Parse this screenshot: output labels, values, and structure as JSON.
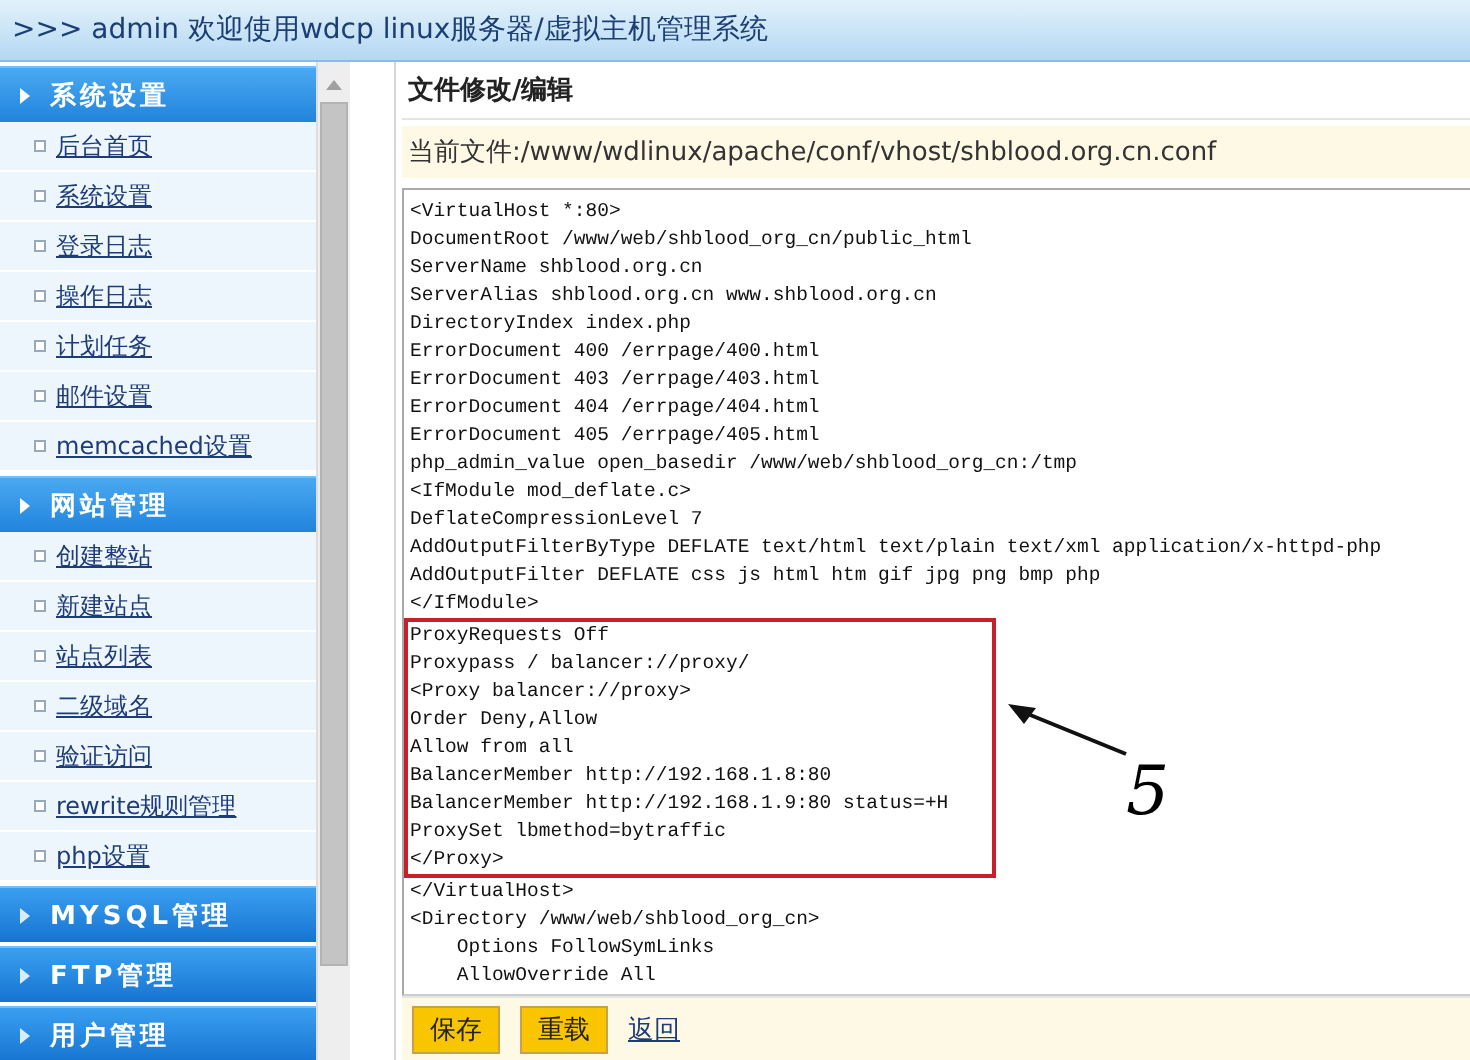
{
  "title_bar": {
    "text": ">>> admin 欢迎使用wdcp linux服务器/虚拟主机管理系统"
  },
  "sidebar": {
    "sections": [
      {
        "label": "系统设置",
        "expanded": true,
        "items": [
          "后台首页",
          "系统设置",
          "登录日志",
          "操作日志",
          "计划任务",
          "邮件设置",
          "memcached设置"
        ]
      },
      {
        "label": "网站管理",
        "expanded": true,
        "items": [
          "创建整站",
          "新建站点",
          "站点列表",
          "二级域名",
          "验证访问",
          "rewrite规则管理",
          "php设置"
        ]
      },
      {
        "label": "MYSQL管理",
        "expanded": false
      },
      {
        "label": "FTP管理",
        "expanded": false
      },
      {
        "label": "用户管理",
        "expanded": false
      }
    ]
  },
  "editor": {
    "heading": "文件修改/编辑",
    "current_file": "当前文件:/www/wdlinux/apache/conf/vhost/shblood.org.cn.conf",
    "lines": [
      {
        "text": "<VirtualHost *:80>",
        "highlighted": false
      },
      {
        "text": "DocumentRoot /www/web/shblood_org_cn/public_html",
        "highlighted": false
      },
      {
        "text": "ServerName shblood.org.cn",
        "highlighted": false
      },
      {
        "text": "ServerAlias shblood.org.cn www.shblood.org.cn",
        "highlighted": false
      },
      {
        "text": "DirectoryIndex index.php",
        "highlighted": false
      },
      {
        "text": "ErrorDocument 400 /errpage/400.html",
        "highlighted": false
      },
      {
        "text": "ErrorDocument 403 /errpage/403.html",
        "highlighted": false
      },
      {
        "text": "ErrorDocument 404 /errpage/404.html",
        "highlighted": false
      },
      {
        "text": "ErrorDocument 405 /errpage/405.html",
        "highlighted": false
      },
      {
        "text": "php_admin_value open_basedir /www/web/shblood_org_cn:/tmp",
        "highlighted": false
      },
      {
        "text": "<IfModule mod_deflate.c>",
        "highlighted": false
      },
      {
        "text": "DeflateCompressionLevel 7",
        "highlighted": false
      },
      {
        "text": "AddOutputFilterByType DEFLATE text/html text/plain text/xml application/x-httpd-php",
        "highlighted": false
      },
      {
        "text": "AddOutputFilter DEFLATE css js html htm gif jpg png bmp php",
        "highlighted": false
      },
      {
        "text": "</IfModule>",
        "highlighted": false
      },
      {
        "text": "ProxyRequests Off",
        "highlighted": true
      },
      {
        "text": "Proxypass / balancer://proxy/",
        "highlighted": true
      },
      {
        "text": "<Proxy balancer://proxy>",
        "highlighted": true
      },
      {
        "text": "Order Deny,Allow",
        "highlighted": true
      },
      {
        "text": "Allow from all",
        "highlighted": true
      },
      {
        "text": "BalancerMember http://192.168.1.8:80",
        "highlighted": true
      },
      {
        "text": "BalancerMember http://192.168.1.9:80 status=+H",
        "highlighted": true
      },
      {
        "text": "ProxySet lbmethod=bytraffic",
        "highlighted": true
      },
      {
        "text": "</Proxy>",
        "highlighted": true
      },
      {
        "text": "</VirtualHost>",
        "highlighted": false
      },
      {
        "text": "<Directory /www/web/shblood_org_cn>",
        "highlighted": false
      },
      {
        "text": "    Options FollowSymLinks",
        "highlighted": false
      },
      {
        "text": "    AllowOverride All",
        "highlighted": false
      }
    ],
    "annotation": {
      "label": "5"
    },
    "buttons": [
      "保存",
      "重载"
    ],
    "back_link": "返回"
  }
}
